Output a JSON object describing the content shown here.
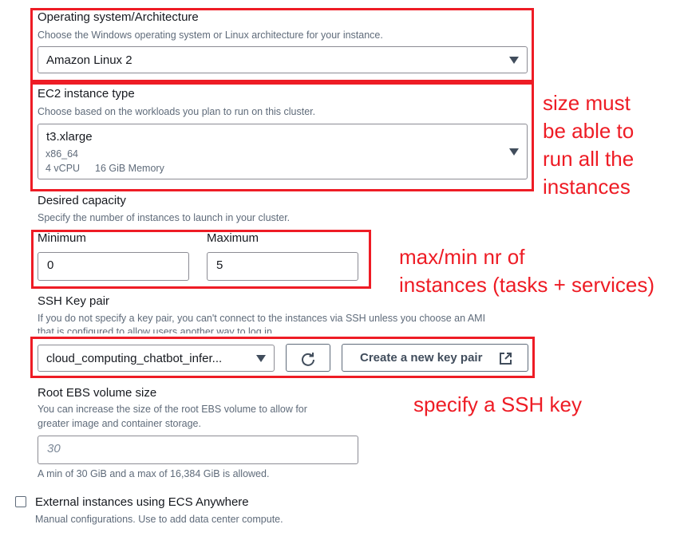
{
  "os_arch": {
    "label": "Operating system/Architecture",
    "description": "Choose the Windows operating system or Linux architecture for your instance.",
    "selected": "Amazon Linux 2",
    "caret_icon": "caret-down-icon"
  },
  "instance_type": {
    "label": "EC2 instance type",
    "description": "Choose based on the workloads you plan to run on this cluster.",
    "selected": "t3.xlarge",
    "architecture": "x86_64",
    "vcpu": "4 vCPU",
    "memory": "16 GiB Memory",
    "caret_icon": "caret-down-icon"
  },
  "desired_capacity": {
    "label": "Desired capacity",
    "description": "Specify the number of instances to launch in your cluster.",
    "minimum_label": "Minimum",
    "minimum_value": "0",
    "maximum_label": "Maximum",
    "maximum_value": "5"
  },
  "ssh_key_pair": {
    "label": "SSH Key pair",
    "description_line1": "If you do not specify a key pair, you can't connect to the instances via SSH unless you choose an AMI",
    "description_line2": "that is configured to allow users another way to log in.",
    "selected": "cloud_computing_chatbot_infer...",
    "refresh_icon": "refresh-icon",
    "create_button_label": "Create a new key pair",
    "external_icon": "external-link-icon"
  },
  "root_ebs": {
    "label": "Root EBS volume size",
    "description_line1": "You can increase the size of the root EBS volume to allow for",
    "description_line2": "greater image and container storage.",
    "placeholder": "30",
    "constraint": "A min of 30 GiB and a max of 16,384 GiB is allowed."
  },
  "ecs_anywhere": {
    "label": "External instances using ECS Anywhere",
    "description": "Manual configurations. Use to add data center compute.",
    "checked": false
  },
  "annotations": {
    "size_note": [
      "size must",
      "be able to",
      "run all the",
      "instances"
    ],
    "capacity_note": [
      "max/min nr of",
      "instances (tasks + services)"
    ],
    "ssh_note": "specify a SSH key",
    "color": "#ee1c25"
  },
  "colors": {
    "text": "#16191f",
    "secondary_text": "#5f6b7a",
    "border": "#8c8c94",
    "annotation_red": "#ee1c25"
  }
}
